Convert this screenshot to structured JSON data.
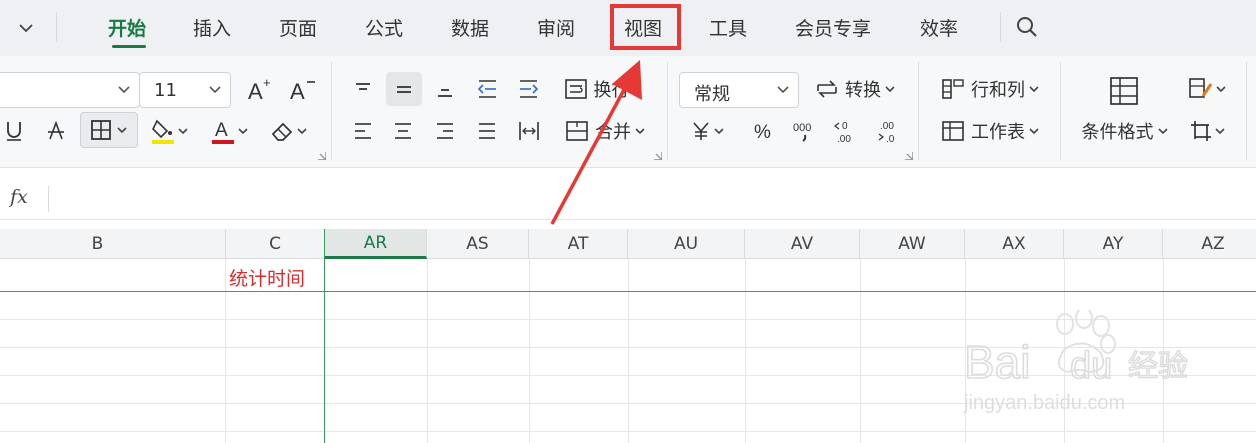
{
  "menu": {
    "tabs": [
      {
        "label": "开始",
        "active": true
      },
      {
        "label": "插入"
      },
      {
        "label": "页面"
      },
      {
        "label": "公式"
      },
      {
        "label": "数据"
      },
      {
        "label": "审阅"
      },
      {
        "label": "视图",
        "highlighted": true
      },
      {
        "label": "工具"
      },
      {
        "label": "会员专享"
      },
      {
        "label": "效率"
      }
    ],
    "collapse_icon": "chevron-down-icon",
    "search_icon": "search-icon"
  },
  "ribbon": {
    "font_size": "11",
    "wrap_label": "换行",
    "merge_label": "合并",
    "number_format": "常规",
    "convert_label": "转换",
    "rows_cols_label": "行和列",
    "worksheet_label": "工作表",
    "cond_format_label": "条件格式"
  },
  "formula_bar": {
    "fx_label": "fx",
    "value": ""
  },
  "grid": {
    "columns": [
      "B",
      "C",
      "AR",
      "AS",
      "AT",
      "AU",
      "AV",
      "AW",
      "AX",
      "AY",
      "AZ"
    ],
    "active_column": "AR",
    "cells": {
      "C1": "统计时间"
    }
  },
  "watermark": {
    "text": "Baidu经验",
    "url": "jingyan.baidu.com"
  },
  "colors": {
    "accent": "#1a7a45",
    "highlight": "#e53935",
    "cell_text": "#d32f2f"
  }
}
